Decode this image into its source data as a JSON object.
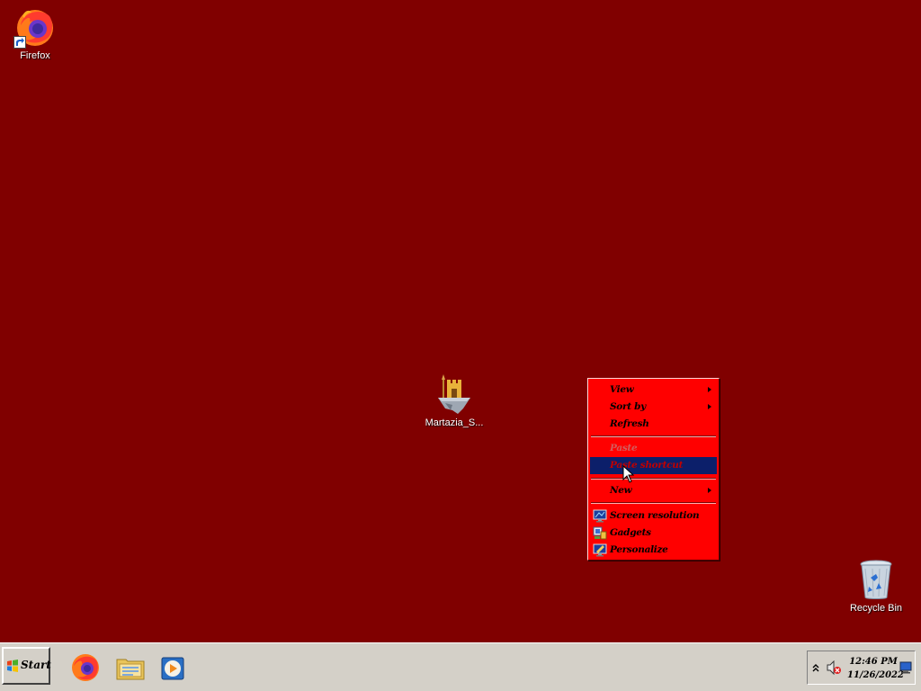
{
  "desktop": {
    "background": "#800000",
    "icons": {
      "firefox": {
        "label": "Firefox",
        "icon": "firefox-icon"
      },
      "martazia": {
        "label": "Martazia_S...",
        "icon": "floating-island-icon"
      },
      "recycle_bin": {
        "label": "Recycle Bin",
        "icon": "recycle-bin-icon"
      }
    }
  },
  "context_menu": {
    "background": "#ff0000",
    "highlight": "#0c1f6a",
    "items": {
      "view": {
        "label": "View",
        "submenu": true
      },
      "sort_by": {
        "label": "Sort by",
        "submenu": true
      },
      "refresh": {
        "label": "Refresh"
      },
      "paste": {
        "label": "Paste",
        "disabled": true
      },
      "paste_shortcut": {
        "label": "Paste shortcut",
        "highlighted": true
      },
      "new": {
        "label": "New",
        "submenu": true
      },
      "screen_resolution": {
        "label": "Screen resolution",
        "icon": "monitor-icon"
      },
      "gadgets": {
        "label": "Gadgets",
        "icon": "gadgets-icon"
      },
      "personalize": {
        "label": "Personalize",
        "icon": "personalize-icon"
      }
    }
  },
  "taskbar": {
    "start_label": "Start",
    "pinned": [
      "firefox-icon",
      "file-explorer-icon",
      "media-player-icon"
    ],
    "tray": {
      "time": "12:46 PM",
      "date": "11/26/2022",
      "icons": [
        "show-hidden-icons-chevron",
        "volume-muted-icon",
        "network-icon"
      ]
    }
  }
}
